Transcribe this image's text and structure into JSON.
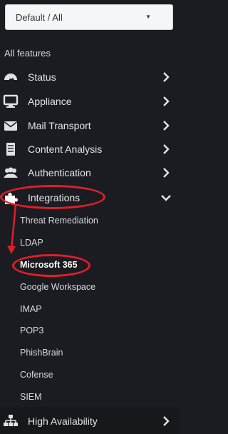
{
  "selector": {
    "value": "Default / All"
  },
  "section_title": "All features",
  "menu": {
    "status": "Status",
    "appliance": "Appliance",
    "mail_transport": "Mail Transport",
    "content_analysis": "Content Analysis",
    "authentication": "Authentication",
    "integrations": "Integrations",
    "high_availability": "High Availability"
  },
  "integrations_sub": [
    "Threat Remediation",
    "LDAP",
    "Microsoft 365",
    "Google Workspace",
    "IMAP",
    "POP3",
    "PhishBrain",
    "Cofense",
    "SIEM"
  ],
  "colors": {
    "highlight": "#e01e2b",
    "background": "#1a1c21"
  }
}
